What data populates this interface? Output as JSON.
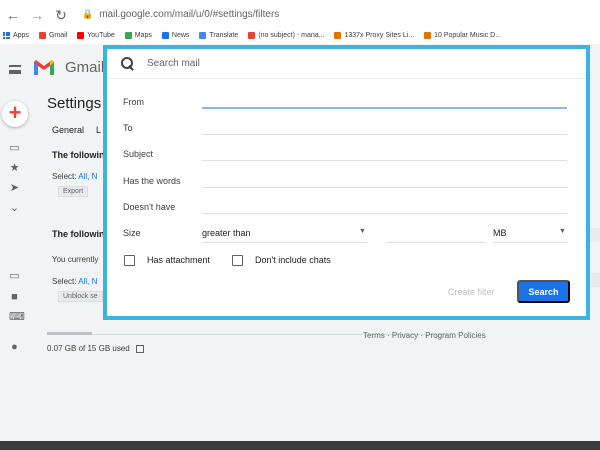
{
  "browser": {
    "url": "mail.google.com/mail/u/0/#settings/filters",
    "bookmarks": [
      {
        "label": "Apps",
        "icon": "apps-grid-icon"
      },
      {
        "label": "Gmail",
        "icon": "gmail-icon",
        "color": "#ea4335"
      },
      {
        "label": "YouTube",
        "icon": "youtube-icon",
        "color": "#ff0000"
      },
      {
        "label": "Maps",
        "icon": "maps-icon",
        "color": "#34a853"
      },
      {
        "label": "News",
        "icon": "news-icon",
        "color": "#1a73e8"
      },
      {
        "label": "Translate",
        "icon": "translate-icon",
        "color": "#4285f4"
      },
      {
        "label": "(no subject) - mana...",
        "icon": "gmail-icon",
        "color": "#ea4335"
      },
      {
        "label": "1337x Proxy Sites Li...",
        "icon": "site-icon",
        "color": "#e37400"
      },
      {
        "label": "10 Popular Music D...",
        "icon": "site-icon",
        "color": "#e37400"
      }
    ]
  },
  "gmail": {
    "brand": "Gmail",
    "page_title": "Settings",
    "tabs": [
      "General",
      "L"
    ],
    "section1": {
      "heading": "The followin",
      "select_prefix": "Select:",
      "select_all": "All,",
      "select_n": "N",
      "button": "Export"
    },
    "section2": {
      "heading": "The followin",
      "current": "You currently",
      "select_prefix": "Select:",
      "select_all": "All,",
      "select_n": "N",
      "button": "Unblock se"
    },
    "storage": "0.07 GB of 15 GB used",
    "footer": "Terms · Privacy · Program Policies"
  },
  "filter_dialog": {
    "search_placeholder": "Search mail",
    "fields": {
      "from": "From",
      "to": "To",
      "subject": "Subject",
      "has_words": "Has the words",
      "doesnt_have": "Doesn't have",
      "size": "Size"
    },
    "size_operator": "greater than",
    "size_unit": "MB",
    "has_attachment": "Has attachment",
    "dont_include_chats": "Don't include chats",
    "create_filter": "Create filter",
    "search_button": "Search",
    "accent": "#1a73e8",
    "frame_color": "#3ab4e0"
  }
}
